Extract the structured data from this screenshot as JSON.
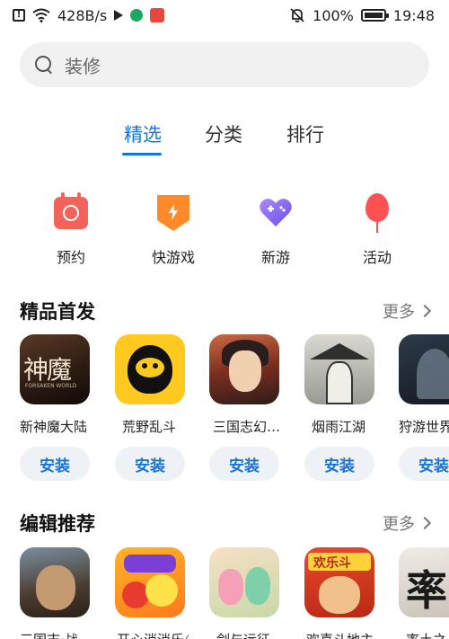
{
  "status_bar": {
    "network_speed": "428B/s",
    "battery_percent": "100%",
    "battery_level": 1.0,
    "time": "19:48",
    "icons": [
      "alert-icon",
      "wifi-icon",
      "play-store-icon",
      "green-app-icon",
      "huawei-app-icon",
      "mute-icon",
      "battery-icon"
    ]
  },
  "search": {
    "placeholder": "装修"
  },
  "tabs": [
    {
      "label": "精选",
      "active": true
    },
    {
      "label": "分类",
      "active": false
    },
    {
      "label": "排行",
      "active": false
    }
  ],
  "quick_entries": [
    {
      "label": "预约",
      "icon": "calendar-icon"
    },
    {
      "label": "快游戏",
      "icon": "bolt-icon"
    },
    {
      "label": "新游",
      "icon": "gamepad-heart-icon"
    },
    {
      "label": "活动",
      "icon": "balloon-icon"
    }
  ],
  "section_featured": {
    "title": "精品首发",
    "more": "更多",
    "apps": [
      {
        "name": "新神魔大陆",
        "install": "安装",
        "icon_text": "神魔",
        "icon_subtext": "FORSAKEN WORLD"
      },
      {
        "name": "荒野乱斗",
        "install": "安装"
      },
      {
        "name": "三国志幻…",
        "install": "安装"
      },
      {
        "name": "烟雨江湖",
        "install": "安装"
      },
      {
        "name": "狩游世界",
        "install": "安装"
      }
    ]
  },
  "section_editor": {
    "title": "编辑推荐",
    "more": "更多",
    "apps": [
      {
        "name": "三国志·战",
        "icon": "game-icon"
      },
      {
        "name": "开心消消乐®",
        "icon": "game-icon"
      },
      {
        "name": "剑与远征",
        "icon": "game-icon"
      },
      {
        "name": "欢喜斗地主",
        "icon": "game-icon",
        "icon_text": "欢乐斗"
      },
      {
        "name": "率土之",
        "icon": "game-icon",
        "icon_text": "率"
      }
    ]
  },
  "colors": {
    "accent": "#1a73d9",
    "install_bg": "#eef1f5",
    "search_bg": "#f1f1f1"
  }
}
